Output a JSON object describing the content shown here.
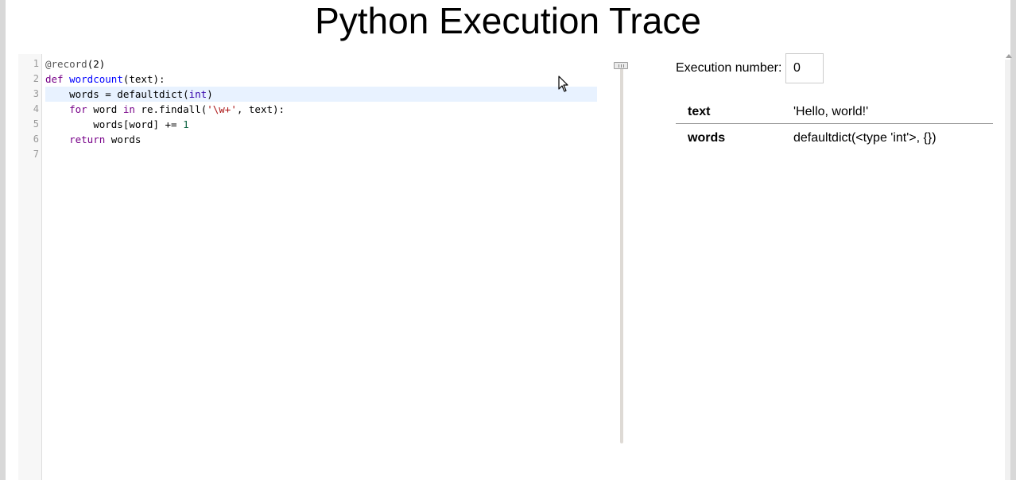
{
  "title": "Python Execution Trace",
  "code_lines": [
    {
      "number": "1",
      "tokens": [
        [
          "meta",
          "@record"
        ],
        [
          "var",
          "(2)"
        ]
      ]
    },
    {
      "number": "2",
      "tokens": [
        [
          "kw",
          "def "
        ],
        [
          "def",
          "wordcount"
        ],
        [
          "var",
          "(text):"
        ]
      ]
    },
    {
      "number": "3",
      "active": true,
      "tokens": [
        [
          "var",
          "    words = defaultdict("
        ],
        [
          "builtin",
          "int"
        ],
        [
          "var",
          ")"
        ]
      ]
    },
    {
      "number": "4",
      "tokens": [
        [
          "var",
          "    "
        ],
        [
          "kw",
          "for"
        ],
        [
          "var",
          " word "
        ],
        [
          "kw",
          "in"
        ],
        [
          "var",
          " re.findall("
        ],
        [
          "str",
          "'\\w+'"
        ],
        [
          "var",
          ", text):"
        ]
      ]
    },
    {
      "number": "5",
      "tokens": [
        [
          "var",
          "        words[word] += "
        ],
        [
          "num",
          "1"
        ]
      ]
    },
    {
      "number": "6",
      "tokens": [
        [
          "var",
          "    "
        ],
        [
          "kw",
          "return"
        ],
        [
          "var",
          " words"
        ]
      ]
    },
    {
      "number": "7",
      "tokens": []
    }
  ],
  "execution": {
    "label": "Execution number:",
    "value": "0"
  },
  "variables": [
    {
      "name": "text",
      "value": "'Hello, world!'"
    },
    {
      "name": "words",
      "value": "defaultdict(<type 'int'>, {})"
    }
  ],
  "slider": {
    "position_fraction": 0
  },
  "icons": {
    "cursor": "mouse-pointer-icon",
    "scroll_up": "scroll-up-arrow-icon"
  }
}
